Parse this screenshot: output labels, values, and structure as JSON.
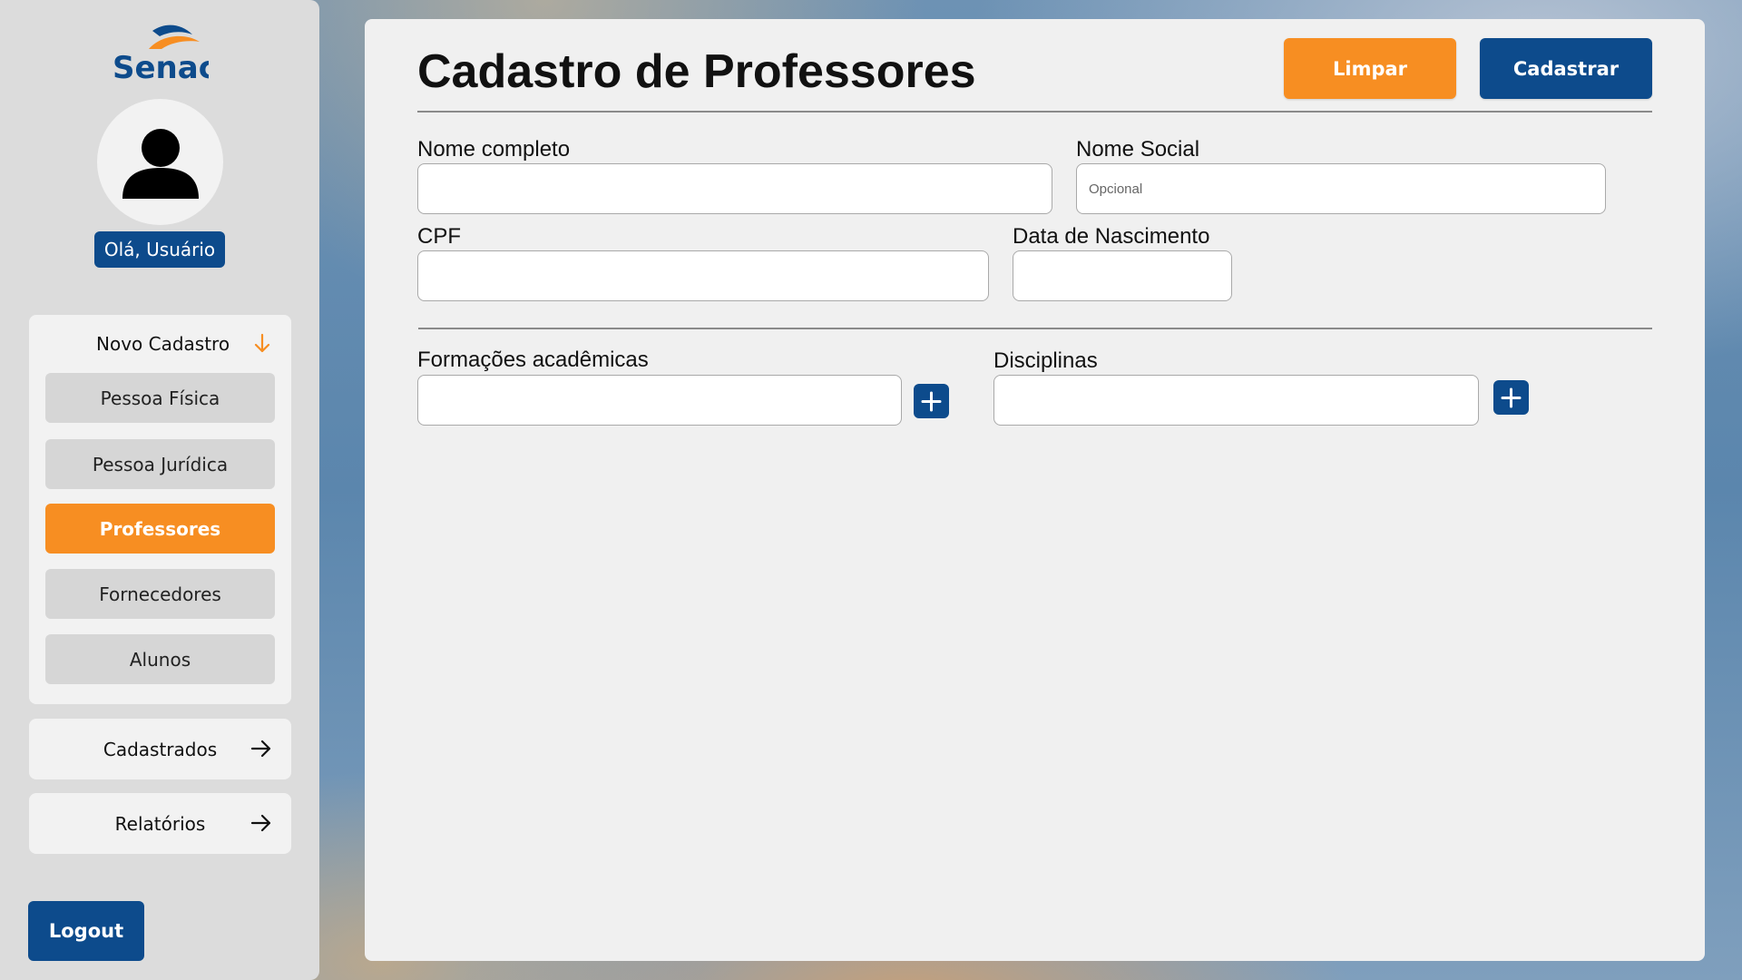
{
  "colors": {
    "accent_orange": "#f78e22",
    "brand_blue": "#0d4b8c",
    "sidebar_bg": "#dcdcdc",
    "panel_bg": "#f0f0f0"
  },
  "sidebar": {
    "logo_text": "Senac",
    "greeting": "Olá, Usuário",
    "new_section": {
      "label": "Novo Cadastro",
      "icon": "arrow-down-icon",
      "items": [
        {
          "label": "Pessoa Física",
          "active": false
        },
        {
          "label": "Pessoa Jurídica",
          "active": false
        },
        {
          "label": "Professores",
          "active": true
        },
        {
          "label": "Fornecedores",
          "active": false
        },
        {
          "label": "Alunos",
          "active": false
        }
      ]
    },
    "registered": {
      "label": "Cadastrados",
      "icon": "arrow-right-icon"
    },
    "reports": {
      "label": "Relatórios",
      "icon": "arrow-right-icon"
    },
    "logout": "Logout"
  },
  "main": {
    "title": "Cadastro de Professores",
    "clear_label": "Limpar",
    "submit_label": "Cadastrar",
    "fields": {
      "full_name": {
        "label": "Nome completo",
        "value": "",
        "placeholder": ""
      },
      "social_name": {
        "label": "Nome Social",
        "value": "",
        "placeholder": "Opcional"
      },
      "cpf": {
        "label": "CPF",
        "value": "",
        "placeholder": ""
      },
      "birth_date": {
        "label": "Data de Nascimento",
        "value": "",
        "placeholder": ""
      },
      "education": {
        "label": "Formações acadêmicas",
        "value": "",
        "placeholder": ""
      },
      "subjects": {
        "label": "Disciplinas",
        "value": "",
        "placeholder": ""
      }
    }
  }
}
